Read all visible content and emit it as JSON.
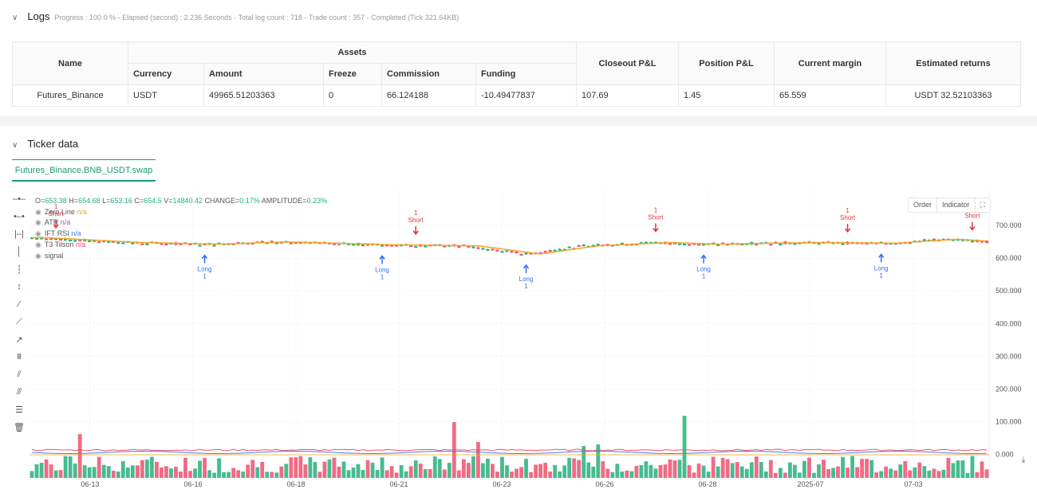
{
  "logs": {
    "title": "Logs",
    "summary": "Progress : 100.0 % - Elapsed (second) : 2.236  Seconds - Total log count : 718 - Trade count : 357 - Completed (Tick 321.64KB)"
  },
  "table": {
    "name_header": "Name",
    "assets_header": "Assets",
    "sub_headers": [
      "Currency",
      "Amount",
      "Freeze",
      "Commission",
      "Funding"
    ],
    "right_headers": [
      "Closeout P&L",
      "Position P&L",
      "Current margin",
      "Estimated returns"
    ],
    "row": [
      "Futures_Binance",
      "USDT",
      "49965.51203363",
      "0",
      "66.124188",
      "-10.49477837",
      "107.69",
      "1.45",
      "65.559",
      "USDT 32.52103363"
    ]
  },
  "ticker": {
    "title": "Ticker data",
    "tab": "Futures_Binance.BNB_USDT.swap"
  },
  "ohlc": {
    "O": "653.38",
    "H": "654.68",
    "L": "653.16",
    "C": "654.5",
    "V": "14840.42",
    "CHANGE": "0.17%",
    "AMPLITUDE": "0.23%"
  },
  "indicators": [
    {
      "name": "Zero Line",
      "value": "n/a",
      "color": "#f5a623"
    },
    {
      "name": "ATR",
      "value": "n/a",
      "color": "#9b59b6"
    },
    {
      "name": "IFT RSI",
      "value": "n/a",
      "color": "#3b82f6"
    },
    {
      "name": "T3 Tilson",
      "value": "n/a",
      "color": "#f0506e"
    },
    {
      "name": "signal",
      "value": ""
    }
  ],
  "chart_buttons": {
    "order": "Order",
    "indicator": "Indicator"
  },
  "chart_data": {
    "type": "candlestick",
    "y_ticks": [
      "700.000",
      "600.000",
      "500.000",
      "400.000",
      "300.000",
      "200.000",
      "100.000",
      "0.000"
    ],
    "x_ticks": [
      "06-13",
      "06-16",
      "06-18",
      "06-21",
      "06-23",
      "06-26",
      "06-28",
      "2025-07",
      "07-03"
    ],
    "candle_count": 200,
    "price_anchors": [
      [
        0,
        665
      ],
      [
        20,
        650
      ],
      [
        36,
        645
      ],
      [
        50,
        652
      ],
      [
        73,
        643
      ],
      [
        90,
        640
      ],
      [
        103,
        615
      ],
      [
        115,
        640
      ],
      [
        130,
        650
      ],
      [
        140,
        645
      ],
      [
        160,
        650
      ],
      [
        177,
        648
      ],
      [
        190,
        660
      ],
      [
        199,
        652
      ]
    ],
    "volume_spikes": [
      [
        10,
        55
      ],
      [
        88,
        70
      ],
      [
        93,
        45
      ],
      [
        115,
        40
      ],
      [
        118,
        42
      ],
      [
        136,
        78
      ]
    ],
    "signals": [
      {
        "type": "Short",
        "qty": "1",
        "index": 5
      },
      {
        "type": "Short",
        "qty": "1",
        "index": 80
      },
      {
        "type": "Short",
        "qty": "1",
        "index": 130
      },
      {
        "type": "Short",
        "qty": "1",
        "index": 170
      },
      {
        "type": "Short",
        "qty": "1",
        "index": 196
      },
      {
        "type": "Long",
        "qty": "1",
        "index": 36
      },
      {
        "type": "Long",
        "qty": "1",
        "index": 73
      },
      {
        "type": "Long",
        "qty": "1",
        "index": 103
      },
      {
        "type": "Long",
        "qty": "1",
        "index": 140
      },
      {
        "type": "Long",
        "qty": "1",
        "index": 177
      }
    ],
    "colors": {
      "up": "#26b07a",
      "down": "#f0506e",
      "t3": "#f5a623",
      "long": "#2f6df6",
      "short": "#e5333f"
    }
  }
}
